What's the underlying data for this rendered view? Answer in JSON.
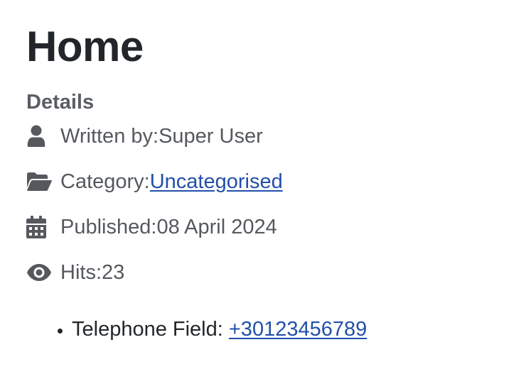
{
  "article": {
    "title": "Home",
    "details_heading": "Details",
    "written_by_label": "Written by: ",
    "author": "Super User",
    "category_label": "Category: ",
    "category": "Uncategorised",
    "published_label": "Published: ",
    "published_date": "08 April 2024",
    "hits_label": "Hits: ",
    "hits": "23"
  },
  "fields": {
    "telephone_label": "Telephone Field: ",
    "telephone_value": "+30123456789"
  },
  "icons": {
    "author": "user-icon",
    "category": "folder-open-icon",
    "published": "calendar-icon",
    "hits": "eye-icon"
  },
  "colors": {
    "text": "#22262a",
    "muted": "#55595e",
    "link": "#224faa"
  }
}
